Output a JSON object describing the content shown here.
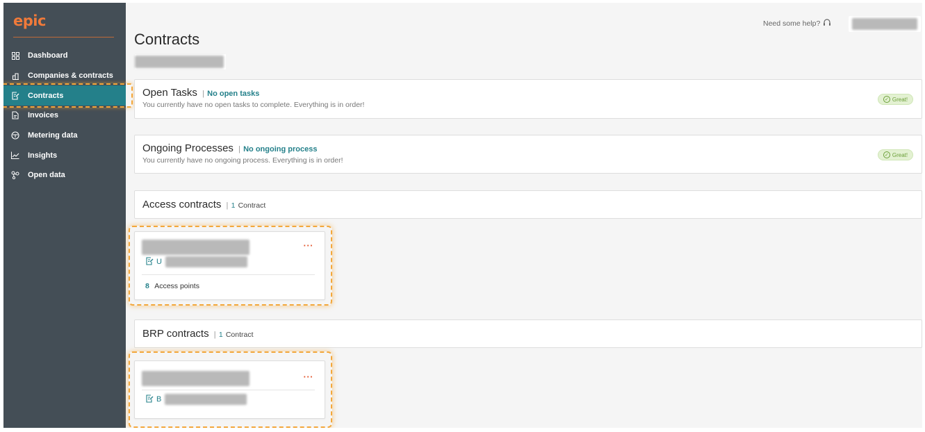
{
  "brand": {
    "logo_text": "epic",
    "accent": "#f07a3a",
    "primary": "#24808a",
    "sidebar_bg": "#444e56"
  },
  "sidebar": {
    "items": [
      {
        "label": "Dashboard",
        "icon": "grid-icon"
      },
      {
        "label": "Companies & contracts",
        "icon": "building-icon"
      },
      {
        "label": "Contracts",
        "icon": "contract-icon",
        "active": true
      },
      {
        "label": "Invoices",
        "icon": "document-icon"
      },
      {
        "label": "Metering data",
        "icon": "meter-icon"
      },
      {
        "label": "Insights",
        "icon": "chart-icon"
      },
      {
        "label": "Open data",
        "icon": "network-icon"
      }
    ]
  },
  "header": {
    "help_text": "Need some help?",
    "help_icon": "headset-icon"
  },
  "page": {
    "title": "Contracts"
  },
  "open_tasks": {
    "title": "Open Tasks",
    "separator": "|",
    "status": "No open tasks",
    "description": "You currently have no open tasks to complete. Everything is in order!",
    "badge": "Great!"
  },
  "ongoing_processes": {
    "title": "Ongoing Processes",
    "separator": "|",
    "status": "No ongoing process",
    "description": "You currently have no ongoing process. Everything is in order!",
    "badge": "Great!"
  },
  "access_contracts": {
    "title": "Access contracts",
    "separator": "|",
    "count": "1",
    "count_label": "Contract",
    "cards": [
      {
        "menu": "···",
        "ref_prefix": "U",
        "access_points_count": "8",
        "access_points_label": "Access points"
      }
    ]
  },
  "brp_contracts": {
    "title": "BRP contracts",
    "separator": "|",
    "count": "1",
    "count_label": "Contract",
    "cards": [
      {
        "menu": "···",
        "ref_prefix": "B"
      }
    ]
  }
}
